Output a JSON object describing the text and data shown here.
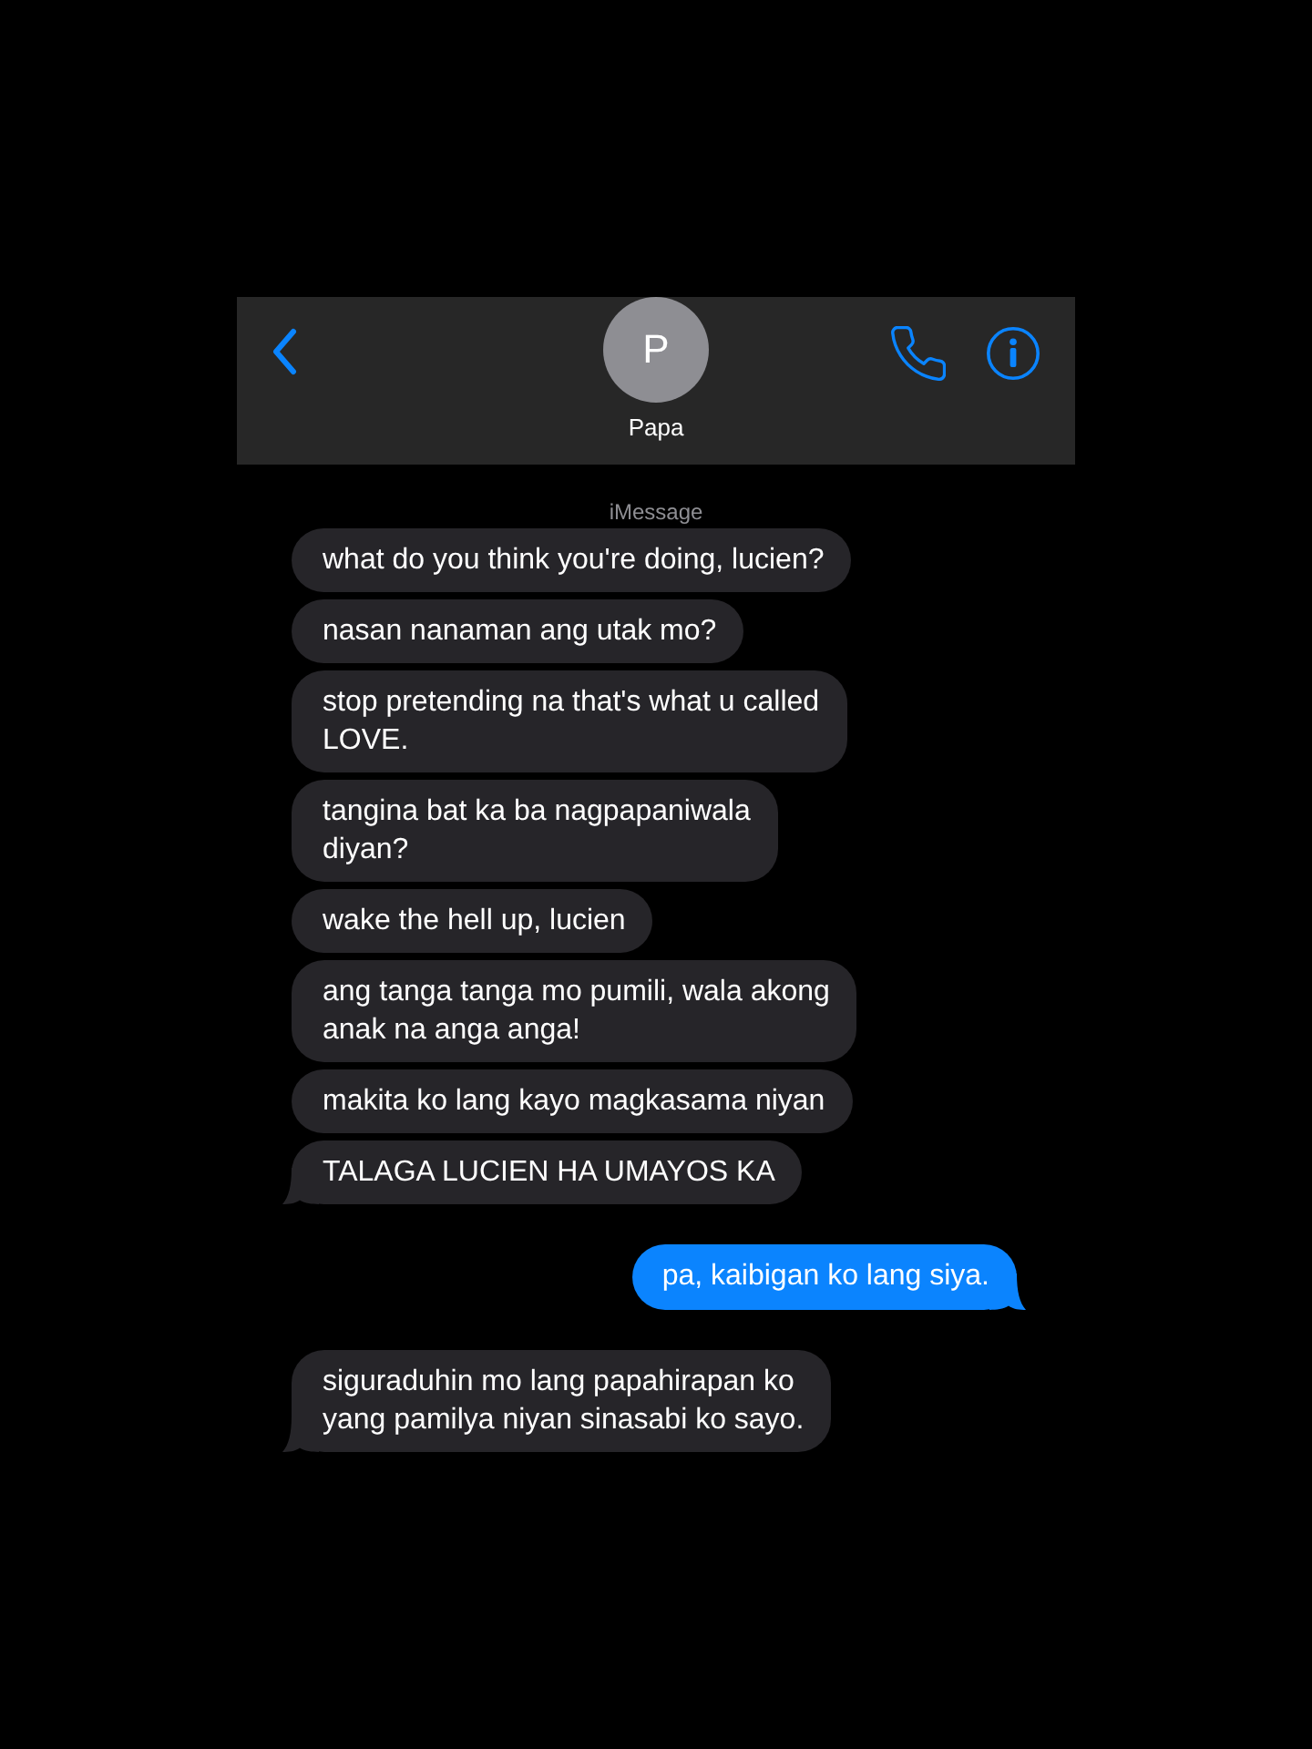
{
  "header": {
    "avatar": {
      "initial": "P"
    },
    "contact_name": "Papa"
  },
  "service_label": "iMessage",
  "messages": [
    {
      "kind": "received",
      "tail": false,
      "lines": [
        "what do you think you're doing, lucien?"
      ]
    },
    {
      "kind": "received",
      "tail": false,
      "lines": [
        "nasan nanaman ang utak mo?"
      ]
    },
    {
      "kind": "received",
      "tail": false,
      "lines": [
        "stop pretending na that's what u called",
        "LOVE."
      ]
    },
    {
      "kind": "received",
      "tail": false,
      "lines": [
        "tangina bat ka ba nagpapaniwala",
        "diyan?"
      ]
    },
    {
      "kind": "received",
      "tail": false,
      "lines": [
        "wake the hell up, lucien"
      ]
    },
    {
      "kind": "received",
      "tail": false,
      "lines": [
        "ang tanga tanga mo pumili, wala akong",
        "anak na anga anga!"
      ]
    },
    {
      "kind": "received",
      "tail": false,
      "lines": [
        "makita ko lang kayo magkasama niyan"
      ]
    },
    {
      "kind": "received",
      "tail": true,
      "lines": [
        "TALAGA LUCIEN HA UMAYOS KA"
      ]
    },
    {
      "kind": "sent",
      "tail": true,
      "lines": [
        "pa, kaibigan ko lang siya."
      ]
    },
    {
      "kind": "received",
      "tail": true,
      "lines": [
        "siguraduhin mo lang papahirapan ko",
        "yang pamilya niyan sinasabi ko sayo."
      ]
    }
  ]
}
